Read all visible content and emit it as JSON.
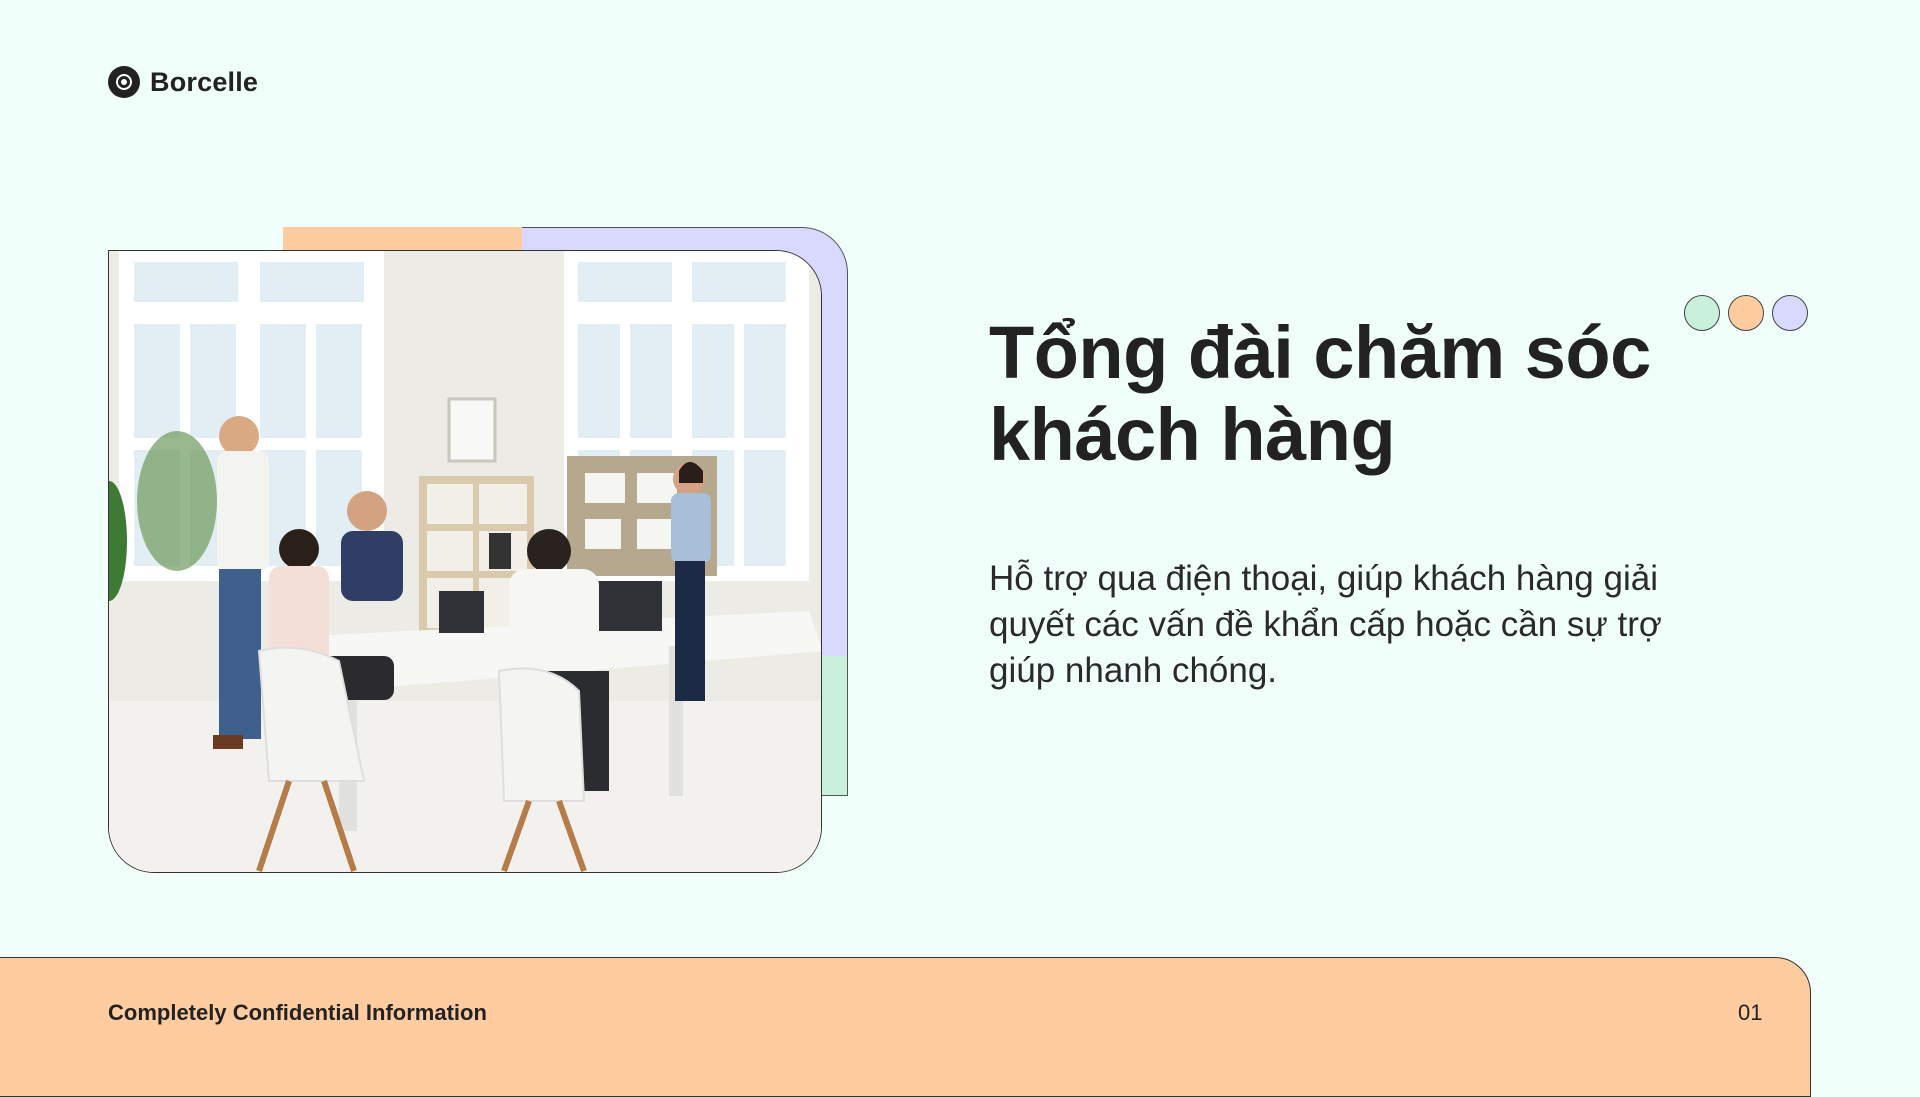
{
  "brand": {
    "name": "Borcelle",
    "icon": "target-icon"
  },
  "hero": {
    "title": "Tổng đài chăm sóc khách hàng",
    "description": "Hỗ trợ qua điện thoại, giúp khách hàng giải quyết các vấn đề khẩn cấp hoặc cần sự trợ giúp nhanh chóng."
  },
  "decor_dots": [
    {
      "color": "#c9f0dc"
    },
    {
      "color": "#ffcc9f"
    },
    {
      "color": "#d9d8fe"
    }
  ],
  "footer": {
    "left_text": "Completely Confidential Information",
    "page_number": "01"
  },
  "colors": {
    "background": "#f1fffb",
    "peach": "#ffcc9f",
    "lavender": "#d9d8fe",
    "mint": "#c9f0dc",
    "text": "#222222"
  }
}
